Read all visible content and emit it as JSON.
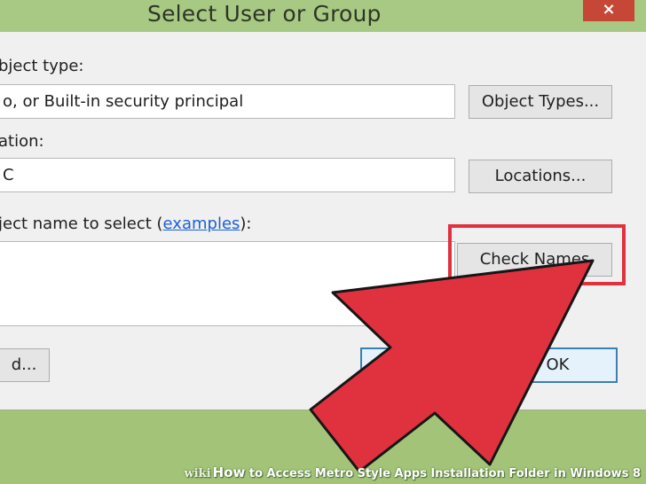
{
  "dialog": {
    "title": "Select User or Group",
    "close_symbol": "×",
    "object_type_label": "bject type:",
    "object_type_value": "o, or Built-in security principal",
    "object_types_button": "Object Types...",
    "location_label": "ation:",
    "location_value": "C",
    "locations_button": "Locations...",
    "object_name_label_prefix": "ject name to select (",
    "object_name_label_link": "examples",
    "object_name_label_suffix": "):",
    "check_names_button": "Check Names",
    "advanced_button": "d...",
    "ok_button": "OK"
  },
  "annotation": {
    "arrow_color": "#e0323e",
    "highlight_color": "#e0323e"
  },
  "watermark": {
    "brand": "wiki",
    "how": "How",
    "text": " to Access Metro Style Apps Installation Folder in Windows 8"
  }
}
